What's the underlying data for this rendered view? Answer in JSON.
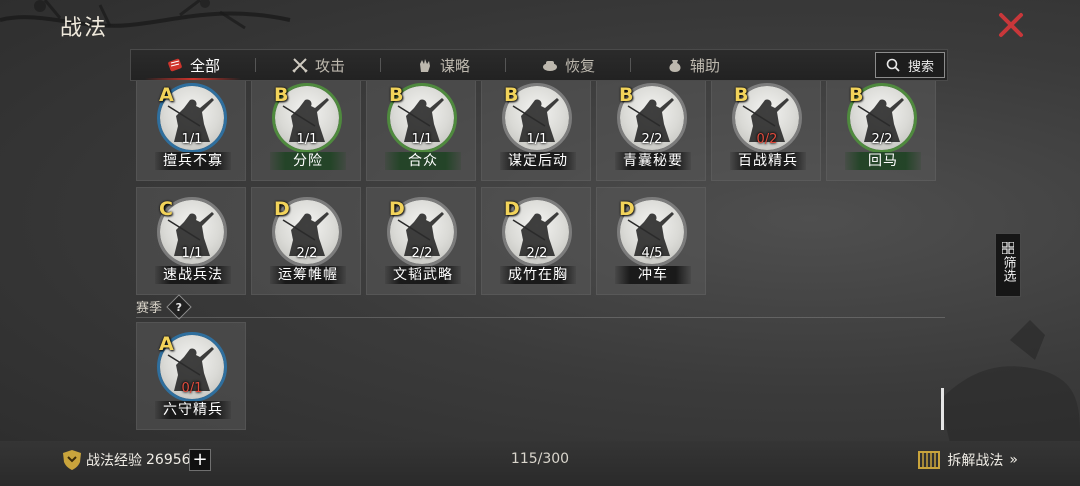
{
  "header": {
    "title": "战法",
    "close_icon": "close-x-icon"
  },
  "tabs": [
    {
      "label": "全部",
      "icon": "scroll-icon",
      "active": true
    },
    {
      "label": "攻击",
      "icon": "crossed-swords-icon",
      "active": false
    },
    {
      "label": "谋略",
      "icon": "hand-icon",
      "active": false
    },
    {
      "label": "恢复",
      "icon": "tea-cup-icon",
      "active": false
    },
    {
      "label": "辅助",
      "icon": "pouch-icon",
      "active": false
    }
  ],
  "search": {
    "label": "搜索",
    "icon": "search-icon"
  },
  "tactics_rows": [
    [
      {
        "grade": "A",
        "count": "1/1",
        "name": "擅兵不寡",
        "ring": "blue",
        "plate": "dark",
        "count_red": false
      },
      {
        "grade": "B",
        "count": "1/1",
        "name": "分险",
        "ring": "green",
        "plate": "green",
        "count_red": false
      },
      {
        "grade": "B",
        "count": "1/1",
        "name": "合众",
        "ring": "green",
        "plate": "green",
        "count_red": false
      },
      {
        "grade": "B",
        "count": "1/1",
        "name": "谋定后动",
        "ring": "grey",
        "plate": "dark",
        "count_red": false
      },
      {
        "grade": "B",
        "count": "2/2",
        "name": "青囊秘要",
        "ring": "grey",
        "plate": "dark",
        "count_red": false
      },
      {
        "grade": "B",
        "count": "0/2",
        "name": "百战精兵",
        "ring": "grey",
        "plate": "dark",
        "count_red": true
      },
      {
        "grade": "B",
        "count": "2/2",
        "name": "回马",
        "ring": "green",
        "plate": "green",
        "count_red": false
      }
    ],
    [
      {
        "grade": "C",
        "count": "1/1",
        "name": "速战兵法",
        "ring": "grey",
        "plate": "dark",
        "count_red": false
      },
      {
        "grade": "D",
        "count": "2/2",
        "name": "运筹帷幄",
        "ring": "grey",
        "plate": "dark",
        "count_red": false
      },
      {
        "grade": "D",
        "count": "2/2",
        "name": "文韬武略",
        "ring": "grey",
        "plate": "dark",
        "count_red": false
      },
      {
        "grade": "D",
        "count": "2/2",
        "name": "成竹在胸",
        "ring": "grey",
        "plate": "dark",
        "count_red": false
      },
      {
        "grade": "D",
        "count": "4/5",
        "name": "冲车",
        "ring": "grey",
        "plate": "dark",
        "count_red": false
      }
    ]
  ],
  "season": {
    "label": "赛季",
    "help": "?",
    "items": [
      {
        "grade": "A",
        "count": "0/1",
        "name": "六守精兵",
        "ring": "blue",
        "plate": "dark",
        "count_red": true
      }
    ]
  },
  "filter": {
    "label": "筛选",
    "icon": "grid-icon"
  },
  "footer": {
    "exp_label": "战法经验",
    "exp_value": "26956",
    "plus": "+",
    "capacity": "115/300",
    "dismantle_label": "拆解战法",
    "dismantle_arrow": "»"
  },
  "colors": {
    "accent_red": "#d0342c",
    "grade_gold": "#f2d35a",
    "ring_blue": "#2f6f9e",
    "ring_green": "#4f8a3e",
    "count_red": "#e04b3d"
  }
}
